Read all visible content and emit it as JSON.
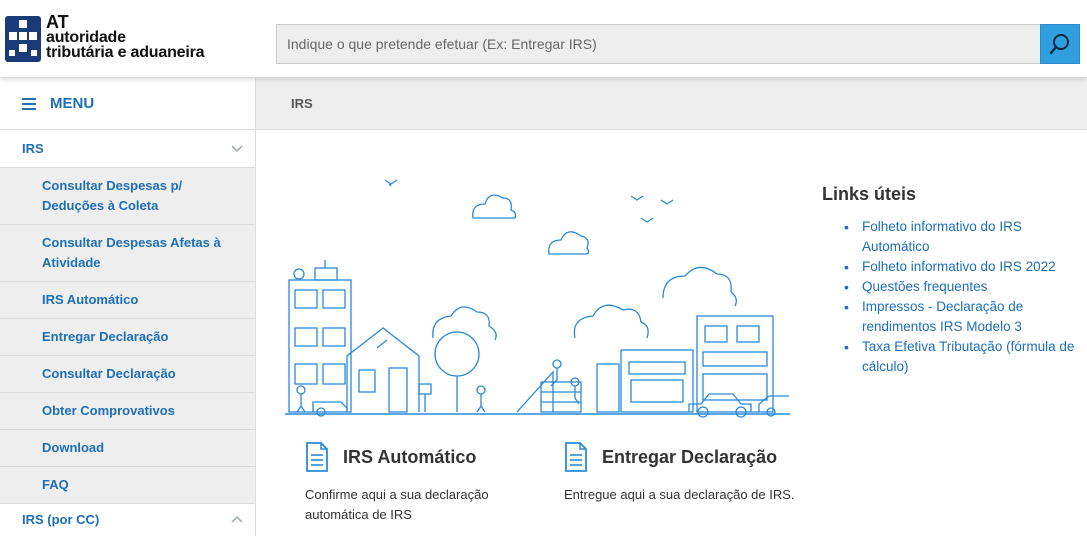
{
  "header": {
    "logo": {
      "line1": "AT",
      "line2": "autoridade",
      "line3": "tributária e aduaneira"
    },
    "search": {
      "placeholder": "Indique o que pretende efetuar (Ex: Entregar IRS)"
    }
  },
  "sidebar": {
    "menu_label": "MENU",
    "sections": [
      {
        "label": "IRS",
        "expanded": true
      },
      {
        "label": "IRS (por CC)",
        "expanded": false
      }
    ],
    "items": [
      {
        "label": "Consultar Despesas p/ Deduções à Coleta"
      },
      {
        "label": "Consultar Despesas Afetas à Atividade"
      },
      {
        "label": "IRS Automático"
      },
      {
        "label": "Entregar Declaração"
      },
      {
        "label": "Consultar Declaração"
      },
      {
        "label": "Obter Comprovativos"
      },
      {
        "label": "Download"
      },
      {
        "label": "FAQ"
      }
    ]
  },
  "breadcrumb": {
    "label": "IRS"
  },
  "cards": [
    {
      "title": "IRS Automático",
      "description": "Confirme aqui a sua declaração automática de IRS",
      "icon": "document-icon"
    },
    {
      "title": "Entregar Declaração",
      "description": "Entregue aqui a sua declaração de IRS.",
      "icon": "document-icon"
    }
  ],
  "links": {
    "title": "Links úteis",
    "items": [
      {
        "label": "Folheto informativo do IRS Automático"
      },
      {
        "label": "Folheto informativo do IRS 2022"
      },
      {
        "label": "Questões frequentes"
      },
      {
        "label": "Impressos - Declaração de rendimentos IRS Modelo 3"
      },
      {
        "label": "Taxa Efetiva Tributação (fórmula de cálculo)"
      }
    ]
  },
  "colors": {
    "accent": "#1d6fb8",
    "search_button": "#2f9fe0",
    "illustration": "#2b8ad8"
  }
}
